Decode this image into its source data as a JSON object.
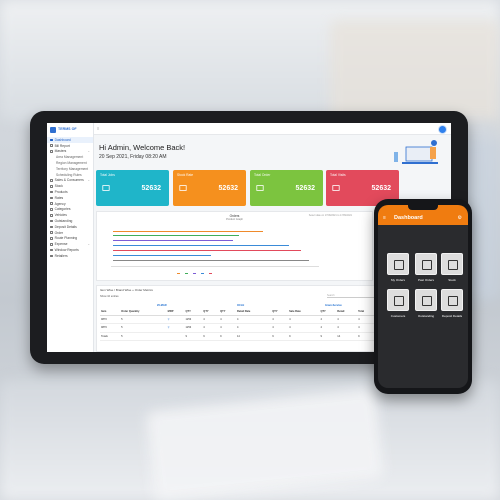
{
  "tablet": {
    "logo_text": "TERMS OF",
    "sidebar": [
      {
        "label": "Dashboard",
        "active": true,
        "sub": false,
        "caret": false
      },
      {
        "label": "Bill Report",
        "active": false,
        "sub": false,
        "caret": false
      },
      {
        "label": "Masters",
        "active": false,
        "sub": false,
        "caret": true
      },
      {
        "label": "Area Management",
        "active": false,
        "sub": true,
        "caret": false
      },
      {
        "label": "Region Management",
        "active": false,
        "sub": true,
        "caret": false
      },
      {
        "label": "Territory Management",
        "active": false,
        "sub": true,
        "caret": false
      },
      {
        "label": "Scheduling Rules",
        "active": false,
        "sub": true,
        "caret": false
      },
      {
        "label": "Sales & Consumers",
        "active": false,
        "sub": false,
        "caret": true
      },
      {
        "label": "Stock",
        "active": false,
        "sub": false,
        "caret": false
      },
      {
        "label": "Products",
        "active": false,
        "sub": false,
        "caret": false
      },
      {
        "label": "Rates",
        "active": false,
        "sub": false,
        "caret": false
      },
      {
        "label": "Agency",
        "active": false,
        "sub": false,
        "caret": false
      },
      {
        "label": "Categories",
        "active": false,
        "sub": false,
        "caret": false
      },
      {
        "label": "Vehicles",
        "active": false,
        "sub": false,
        "caret": false
      },
      {
        "label": "Outstanding",
        "active": false,
        "sub": false,
        "caret": false
      },
      {
        "label": "Deposit Details",
        "active": false,
        "sub": false,
        "caret": false
      },
      {
        "label": "Order",
        "active": false,
        "sub": false,
        "caret": false
      },
      {
        "label": "Route Planning",
        "active": false,
        "sub": false,
        "caret": false
      },
      {
        "label": "Expense",
        "active": false,
        "sub": false,
        "caret": true
      },
      {
        "label": "Window Reports",
        "active": false,
        "sub": false,
        "caret": false
      },
      {
        "label": "Retailers",
        "active": false,
        "sub": false,
        "caret": false
      }
    ],
    "greeting": "Hi Admin, Welcome Back!",
    "date": "20 Sep 2021, Friday 08:20 AM",
    "cards": [
      {
        "label": "Total Jobs",
        "value": "52632",
        "color": "#1fb5c9"
      },
      {
        "label": "Stock Rate",
        "value": "52632",
        "color": "#f5901e"
      },
      {
        "label": "Total Order",
        "value": "52632",
        "color": "#7cc43f"
      },
      {
        "label": "Total Visits",
        "value": "52632",
        "color": "#e24a5c"
      }
    ],
    "chart": {
      "title": "Orders",
      "subtitle": "Product Graph",
      "note": "Select date on 17/09/2021 to 17/09/2021"
    },
    "consumer": {
      "title": "Total Consumer",
      "value": "500"
    },
    "table": {
      "heading": "Item Wise / Brand Wise + Order Metrics",
      "filter": "Filter By",
      "show": "Show  10  entries",
      "search": "Search",
      "groups": [
        "20-MAR",
        "OCLE",
        "Gram-Service",
        "BRANDING"
      ],
      "headers": [
        "Item",
        "Order Quantity",
        "MRP",
        "QTY",
        "QTY",
        "QTY",
        "Retail Rate",
        "QTY",
        "Sale Rate",
        "QTY",
        "Retail",
        "Total",
        "Retail Rate",
        "Total",
        "Retail"
      ],
      "rows": [
        [
          "9870",
          "5",
          "",
          "1253",
          "4",
          "4",
          "4",
          "4",
          "4",
          "4",
          "4",
          "4",
          "4",
          "4",
          "4"
        ],
        [
          "9876",
          "5",
          "",
          "1253",
          "4",
          "4",
          "4",
          "4",
          "4",
          "4",
          "4",
          "4",
          "4",
          "4",
          "4"
        ],
        [
          "Totals",
          "5",
          "",
          "9",
          "9",
          "9",
          "14",
          "9",
          "9",
          "9",
          "14",
          "9",
          "9",
          "9",
          "14"
        ]
      ]
    }
  },
  "phone": {
    "title": "Dashboard",
    "tiles": [
      "My Orders",
      "Past Orders",
      "Stock",
      "Customers",
      "Outstanding",
      "Deposit Details"
    ]
  }
}
